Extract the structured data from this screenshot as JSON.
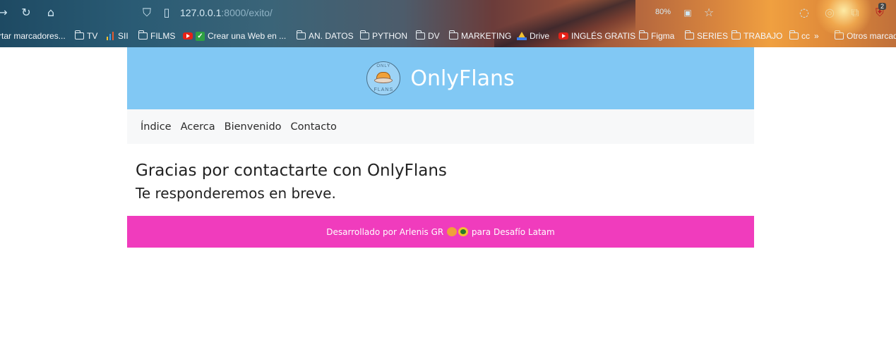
{
  "browser": {
    "url_host": "127.0.0.1",
    "url_path": ":8000/exito/",
    "zoom": "80%",
    "extension_badge": "2",
    "bookmarks": [
      {
        "label": "rtar marcadores...",
        "icon": "none"
      },
      {
        "label": "TV",
        "icon": "folder-icon"
      },
      {
        "label": "SII",
        "icon": "chart-icon"
      },
      {
        "label": "FILMS",
        "icon": "folder-icon"
      },
      {
        "label": "Crear una Web en ...",
        "icon": "youtube-check-icon"
      },
      {
        "label": "AN. DATOS",
        "icon": "folder-icon"
      },
      {
        "label": "PYTHON",
        "icon": "folder-icon"
      },
      {
        "label": "DV",
        "icon": "folder-icon"
      },
      {
        "label": "MARKETING",
        "icon": "folder-icon"
      },
      {
        "label": "Drive",
        "icon": "drive-icon"
      },
      {
        "label": "INGLÉS GRATIS",
        "icon": "youtube-icon"
      },
      {
        "label": "Figma",
        "icon": "folder-icon"
      },
      {
        "label": "SERIES",
        "icon": "folder-icon"
      },
      {
        "label": "TRABAJO",
        "icon": "folder-icon"
      },
      {
        "label": "cc",
        "icon": "folder-icon"
      },
      {
        "label": "Otros marcad",
        "icon": "folder-icon"
      }
    ]
  },
  "site": {
    "brand": "OnlyFlans",
    "logo_text_top": "ONLY",
    "logo_text_bottom": "FLANS",
    "nav": [
      "Índice",
      "Acerca",
      "Bienvenido",
      "Contacto"
    ],
    "heading": "Gracias por contactarte con OnlyFlans",
    "subheading": "Te responderemos en breve.",
    "footer_before": "Desarrollado por Arlenis GR",
    "footer_after": "para Desafío Latam"
  },
  "colors": {
    "header_bg": "#81c8f4",
    "nav_bg": "#f7f8f9",
    "footer_bg": "#f03cbd"
  }
}
